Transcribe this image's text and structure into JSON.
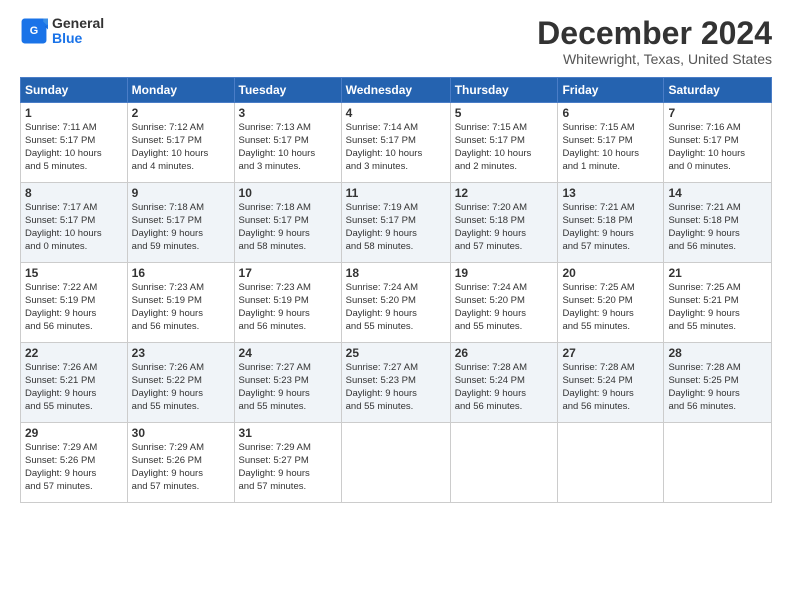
{
  "logo": {
    "line1": "General",
    "line2": "Blue"
  },
  "header": {
    "month": "December 2024",
    "location": "Whitewright, Texas, United States"
  },
  "columns": [
    "Sunday",
    "Monday",
    "Tuesday",
    "Wednesday",
    "Thursday",
    "Friday",
    "Saturday"
  ],
  "weeks": [
    [
      {
        "day": "1",
        "info": "Sunrise: 7:11 AM\nSunset: 5:17 PM\nDaylight: 10 hours\nand 5 minutes."
      },
      {
        "day": "2",
        "info": "Sunrise: 7:12 AM\nSunset: 5:17 PM\nDaylight: 10 hours\nand 4 minutes."
      },
      {
        "day": "3",
        "info": "Sunrise: 7:13 AM\nSunset: 5:17 PM\nDaylight: 10 hours\nand 3 minutes."
      },
      {
        "day": "4",
        "info": "Sunrise: 7:14 AM\nSunset: 5:17 PM\nDaylight: 10 hours\nand 3 minutes."
      },
      {
        "day": "5",
        "info": "Sunrise: 7:15 AM\nSunset: 5:17 PM\nDaylight: 10 hours\nand 2 minutes."
      },
      {
        "day": "6",
        "info": "Sunrise: 7:15 AM\nSunset: 5:17 PM\nDaylight: 10 hours\nand 1 minute."
      },
      {
        "day": "7",
        "info": "Sunrise: 7:16 AM\nSunset: 5:17 PM\nDaylight: 10 hours\nand 0 minutes."
      }
    ],
    [
      {
        "day": "8",
        "info": "Sunrise: 7:17 AM\nSunset: 5:17 PM\nDaylight: 10 hours\nand 0 minutes."
      },
      {
        "day": "9",
        "info": "Sunrise: 7:18 AM\nSunset: 5:17 PM\nDaylight: 9 hours\nand 59 minutes."
      },
      {
        "day": "10",
        "info": "Sunrise: 7:18 AM\nSunset: 5:17 PM\nDaylight: 9 hours\nand 58 minutes."
      },
      {
        "day": "11",
        "info": "Sunrise: 7:19 AM\nSunset: 5:17 PM\nDaylight: 9 hours\nand 58 minutes."
      },
      {
        "day": "12",
        "info": "Sunrise: 7:20 AM\nSunset: 5:18 PM\nDaylight: 9 hours\nand 57 minutes."
      },
      {
        "day": "13",
        "info": "Sunrise: 7:21 AM\nSunset: 5:18 PM\nDaylight: 9 hours\nand 57 minutes."
      },
      {
        "day": "14",
        "info": "Sunrise: 7:21 AM\nSunset: 5:18 PM\nDaylight: 9 hours\nand 56 minutes."
      }
    ],
    [
      {
        "day": "15",
        "info": "Sunrise: 7:22 AM\nSunset: 5:19 PM\nDaylight: 9 hours\nand 56 minutes."
      },
      {
        "day": "16",
        "info": "Sunrise: 7:23 AM\nSunset: 5:19 PM\nDaylight: 9 hours\nand 56 minutes."
      },
      {
        "day": "17",
        "info": "Sunrise: 7:23 AM\nSunset: 5:19 PM\nDaylight: 9 hours\nand 56 minutes."
      },
      {
        "day": "18",
        "info": "Sunrise: 7:24 AM\nSunset: 5:20 PM\nDaylight: 9 hours\nand 55 minutes."
      },
      {
        "day": "19",
        "info": "Sunrise: 7:24 AM\nSunset: 5:20 PM\nDaylight: 9 hours\nand 55 minutes."
      },
      {
        "day": "20",
        "info": "Sunrise: 7:25 AM\nSunset: 5:20 PM\nDaylight: 9 hours\nand 55 minutes."
      },
      {
        "day": "21",
        "info": "Sunrise: 7:25 AM\nSunset: 5:21 PM\nDaylight: 9 hours\nand 55 minutes."
      }
    ],
    [
      {
        "day": "22",
        "info": "Sunrise: 7:26 AM\nSunset: 5:21 PM\nDaylight: 9 hours\nand 55 minutes."
      },
      {
        "day": "23",
        "info": "Sunrise: 7:26 AM\nSunset: 5:22 PM\nDaylight: 9 hours\nand 55 minutes."
      },
      {
        "day": "24",
        "info": "Sunrise: 7:27 AM\nSunset: 5:23 PM\nDaylight: 9 hours\nand 55 minutes."
      },
      {
        "day": "25",
        "info": "Sunrise: 7:27 AM\nSunset: 5:23 PM\nDaylight: 9 hours\nand 55 minutes."
      },
      {
        "day": "26",
        "info": "Sunrise: 7:28 AM\nSunset: 5:24 PM\nDaylight: 9 hours\nand 56 minutes."
      },
      {
        "day": "27",
        "info": "Sunrise: 7:28 AM\nSunset: 5:24 PM\nDaylight: 9 hours\nand 56 minutes."
      },
      {
        "day": "28",
        "info": "Sunrise: 7:28 AM\nSunset: 5:25 PM\nDaylight: 9 hours\nand 56 minutes."
      }
    ],
    [
      {
        "day": "29",
        "info": "Sunrise: 7:29 AM\nSunset: 5:26 PM\nDaylight: 9 hours\nand 57 minutes."
      },
      {
        "day": "30",
        "info": "Sunrise: 7:29 AM\nSunset: 5:26 PM\nDaylight: 9 hours\nand 57 minutes."
      },
      {
        "day": "31",
        "info": "Sunrise: 7:29 AM\nSunset: 5:27 PM\nDaylight: 9 hours\nand 57 minutes."
      },
      null,
      null,
      null,
      null
    ]
  ]
}
